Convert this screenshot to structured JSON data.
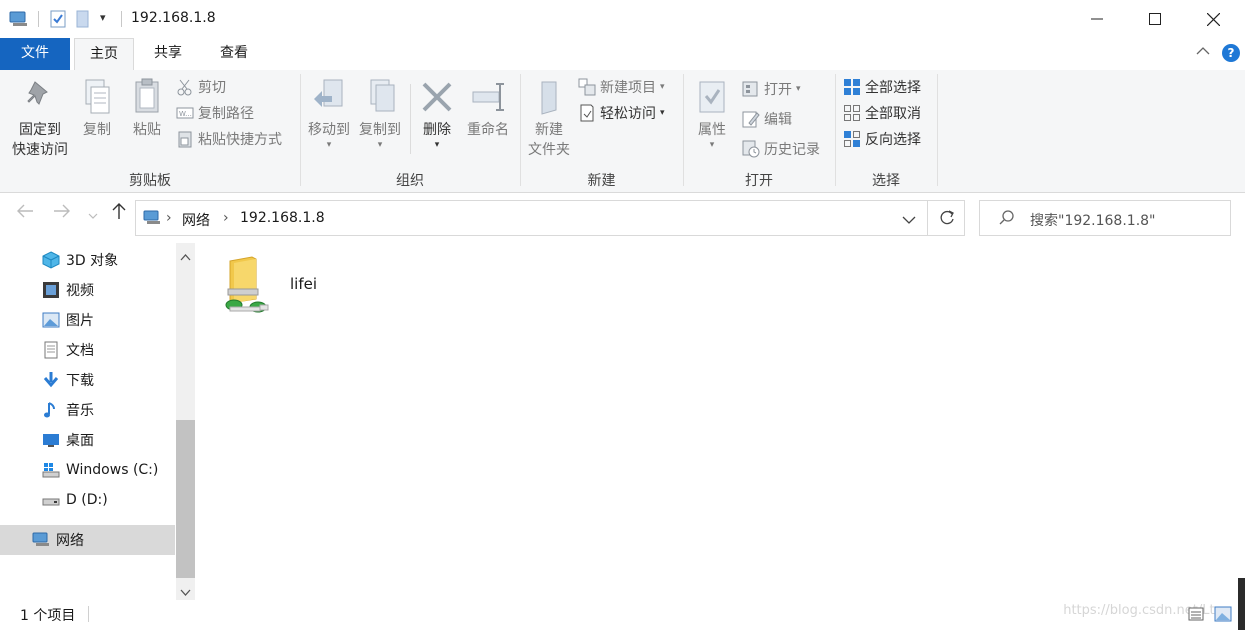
{
  "window": {
    "title": "192.168.1.8",
    "controls": {
      "minimize": "—",
      "maximize": "☐",
      "close": "✕"
    }
  },
  "tabs": {
    "file": "文件",
    "home": "主页",
    "share": "共享",
    "view": "查看"
  },
  "ribbon": {
    "clipboard": {
      "pin_line1": "固定到",
      "pin_line2": "快速访问",
      "copy": "复制",
      "paste": "粘贴",
      "cut": "剪切",
      "copy_path": "复制路径",
      "paste_shortcut": "粘贴快捷方式",
      "label": "剪贴板"
    },
    "organize": {
      "move_to": "移动到",
      "copy_to": "复制到",
      "delete": "删除",
      "rename": "重命名",
      "label": "组织"
    },
    "new": {
      "new_folder_line1": "新建",
      "new_folder_line2": "文件夹",
      "new_item": "新建项目",
      "easy_access": "轻松访问",
      "label": "新建"
    },
    "open": {
      "properties": "属性",
      "open": "打开",
      "edit": "编辑",
      "history": "历史记录",
      "label": "打开"
    },
    "select": {
      "select_all": "全部选择",
      "select_none": "全部取消",
      "invert": "反向选择",
      "label": "选择"
    }
  },
  "address": {
    "crumbs": [
      "网络",
      "192.168.1.8"
    ],
    "search_placeholder": "搜索\"192.168.1.8\""
  },
  "nav": {
    "items": [
      {
        "label": "3D 对象",
        "icon": "3d-objects-icon"
      },
      {
        "label": "视频",
        "icon": "video-icon"
      },
      {
        "label": "图片",
        "icon": "pictures-icon"
      },
      {
        "label": "文档",
        "icon": "documents-icon"
      },
      {
        "label": "下载",
        "icon": "downloads-icon"
      },
      {
        "label": "音乐",
        "icon": "music-icon"
      },
      {
        "label": "桌面",
        "icon": "desktop-icon"
      },
      {
        "label": "Windows (C:)",
        "icon": "windows-drive-icon"
      },
      {
        "label": "D (D:)",
        "icon": "drive-icon"
      },
      {
        "label": "网络",
        "icon": "network-icon",
        "selected": true
      }
    ]
  },
  "content": {
    "items": [
      {
        "name": "lifei",
        "icon": "shared-folder-icon"
      }
    ]
  },
  "status": {
    "count": "1 个项目",
    "watermark": "https://blog.csdn.net/Lt..."
  },
  "colors": {
    "accent": "#1565c0",
    "selected": "#d9d9d9",
    "folder": "#f5c84c"
  }
}
